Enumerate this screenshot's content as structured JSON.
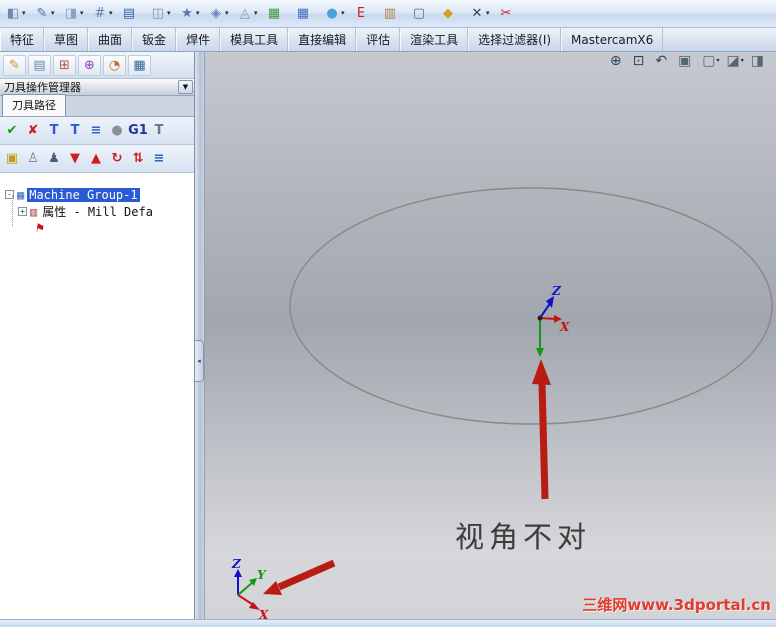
{
  "colors": {
    "selection_blue": "#2a5ad4",
    "annotation_arrow_red": "#b81c12",
    "watermark_red": "#e23c2e",
    "axis_x_red": "#cc1111",
    "axis_y_green": "#119911",
    "axis_z_blue": "#1111cc",
    "active_tab_cream": "#f3eed6"
  },
  "top_toolbar": {
    "buttons": [
      {
        "name": "features-flyout",
        "glyph": "◧",
        "color": "#7188ae",
        "dd": "▾"
      },
      {
        "name": "sketch-flyout",
        "glyph": "✎",
        "color": "#4a6fa5",
        "dd": "▾"
      },
      {
        "name": "surfaces-flyout",
        "glyph": "◨",
        "color": "#8aa0c0",
        "dd": "▾"
      },
      {
        "name": "evaluate-flyout",
        "glyph": "#",
        "color": "#6a82a8",
        "dd": "▾"
      },
      {
        "name": "document-icon",
        "glyph": "▤",
        "color": "#3a66b0",
        "dd": ""
      },
      {
        "name": "view-flyout",
        "glyph": "◫",
        "color": "#7a92b8",
        "dd": "▾"
      },
      {
        "name": "tools-flyout",
        "glyph": "★",
        "color": "#5577aa",
        "dd": "▾"
      },
      {
        "name": "assembly-flyout",
        "glyph": "◈",
        "color": "#6688bb",
        "dd": "▾"
      },
      {
        "name": "drawing-flyout",
        "glyph": "◬",
        "color": "#7799cc",
        "dd": "▾"
      },
      {
        "name": "grid-green-icon",
        "glyph": "▦",
        "color": "#3f9a3f",
        "dd": ""
      },
      {
        "name": "grid-blue-icon",
        "glyph": "▦",
        "color": "#3f6fbf",
        "dd": ""
      },
      {
        "name": "sphere-flyout",
        "glyph": "●",
        "color": "#4aa0d8",
        "dd": "▾"
      },
      {
        "name": "red-e-icon",
        "glyph": "E",
        "color": "#cc2222",
        "dd": ""
      },
      {
        "name": "book-icon",
        "glyph": "▥",
        "color": "#b08040",
        "dd": ""
      },
      {
        "name": "page-icon",
        "glyph": "▢",
        "color": "#556677",
        "dd": ""
      },
      {
        "name": "gem-icon",
        "glyph": "◆",
        "color": "#d8a020",
        "dd": ""
      },
      {
        "name": "axis-x-flyout",
        "glyph": "✕",
        "color": "#334455",
        "dd": "▾"
      },
      {
        "name": "cut-red-icon",
        "glyph": "✂",
        "color": "#cc2222",
        "dd": ""
      }
    ]
  },
  "ribbon": {
    "tabs": [
      {
        "name": "tab-features",
        "label": "特征"
      },
      {
        "name": "tab-sketch",
        "label": "草图"
      },
      {
        "name": "tab-surface",
        "label": "曲面"
      },
      {
        "name": "tab-sheet-metal",
        "label": "钣金"
      },
      {
        "name": "tab-weldments",
        "label": "焊件"
      },
      {
        "name": "tab-mold-tools",
        "label": "模具工具"
      },
      {
        "name": "tab-direct-editing",
        "label": "直接编辑"
      },
      {
        "name": "tab-evaluate",
        "label": "评估"
      },
      {
        "name": "tab-render-tools",
        "label": "渲染工具"
      },
      {
        "name": "tab-selection-filter",
        "label": "选择过滤器(I)"
      },
      {
        "name": "tab-mastercamx6",
        "label": "MastercamX6"
      }
    ]
  },
  "left_panel": {
    "manager_icons": [
      {
        "name": "toolpath-manager-icon",
        "glyph": "✎",
        "color": "#c89820"
      },
      {
        "name": "notes-manager-icon",
        "glyph": "▤",
        "color": "#6a88b0"
      },
      {
        "name": "hierarchy-manager-icon",
        "glyph": "⊞",
        "color": "#b05050"
      },
      {
        "name": "planes-manager-icon",
        "glyph": "⊕",
        "color": "#8844bb"
      },
      {
        "name": "stats-manager-icon",
        "glyph": "◔",
        "color": "#cc6622"
      },
      {
        "name": "display-manager-icon",
        "glyph": "▦",
        "color": "#336699"
      }
    ],
    "title": "刀具操作管理器",
    "title_dropdown": "▼",
    "tab": "刀具路径",
    "toolbar1": [
      {
        "name": "select-all-ops-button",
        "glyph": "✔",
        "color": "#189818"
      },
      {
        "name": "deselect-ops-button",
        "glyph": "✘",
        "color": "#cc2020"
      },
      {
        "name": "toolpath-insert-button",
        "glyph": "T",
        "color": "#2a5ad4"
      },
      {
        "name": "toolpath-delete-button",
        "glyph": "T",
        "color": "#2a5ad4"
      },
      {
        "name": "layers-button",
        "glyph": "≡",
        "color": "#2a66c8"
      },
      {
        "name": "stock-button",
        "glyph": "●",
        "color": "#8a9098"
      },
      {
        "name": "g1-button",
        "glyph": "G1",
        "color": "#223399"
      },
      {
        "name": "toolpath-config-button",
        "glyph": "T",
        "color": "#667788"
      }
    ],
    "toolbar2": [
      {
        "name": "lock-button",
        "glyph": "▣",
        "color": "#c09a18"
      },
      {
        "name": "ghost-toggle-button",
        "glyph": "♙",
        "color": "#707a8c"
      },
      {
        "name": "ghost-toggle2-button",
        "glyph": "♟",
        "color": "#4a5a84"
      },
      {
        "name": "move-down-button",
        "glyph": "▼",
        "color": "#cc2020"
      },
      {
        "name": "move-up-button",
        "glyph": "▲",
        "color": "#cc2020"
      },
      {
        "name": "scroll-insert-button",
        "glyph": "↻",
        "color": "#cc2020"
      },
      {
        "name": "swap-button",
        "glyph": "⇅",
        "color": "#cc2020"
      },
      {
        "name": "layers2-button",
        "glyph": "≡",
        "color": "#2a66c8"
      }
    ],
    "tree": {
      "root": {
        "expander": "-",
        "icon_glyph": "▦",
        "icon_color": "#4a78c8",
        "label": "Machine Group-1"
      },
      "child": {
        "expander": "+",
        "icon_glyph": "▥",
        "icon_color": "#b05050",
        "label": "属性 - Mill Defa"
      },
      "insert_marker_glyph": "⚑"
    }
  },
  "splitter": {
    "arrow": "◂"
  },
  "viewport": {
    "zoom_toolbar": [
      {
        "name": "zoom-in-icon",
        "glyph": "⊕",
        "color": "#334466",
        "dd": ""
      },
      {
        "name": "zoom-window-icon",
        "glyph": "⊡",
        "color": "#334466",
        "dd": ""
      },
      {
        "name": "previous-view-icon",
        "glyph": "↶",
        "color": "#334466",
        "dd": ""
      },
      {
        "name": "section-view-icon",
        "glyph": "▣",
        "color": "#556677",
        "dd": ""
      },
      {
        "name": "view-orientation-flyout",
        "glyph": "▢",
        "color": "#556677",
        "dd": "▾"
      },
      {
        "name": "display-style-flyout",
        "glyph": "◪",
        "color": "#556677",
        "dd": "▾"
      },
      {
        "name": "hide-show-flyout",
        "glyph": "◨",
        "color": "#556677",
        "dd": ""
      }
    ],
    "center_triad": {
      "x": "X",
      "z": "Z"
    },
    "corner_triad": {
      "x": "X",
      "y": "Y",
      "z": "Z"
    },
    "annotation": "视角不对",
    "watermark": "三维网www.3dportal.cn"
  }
}
